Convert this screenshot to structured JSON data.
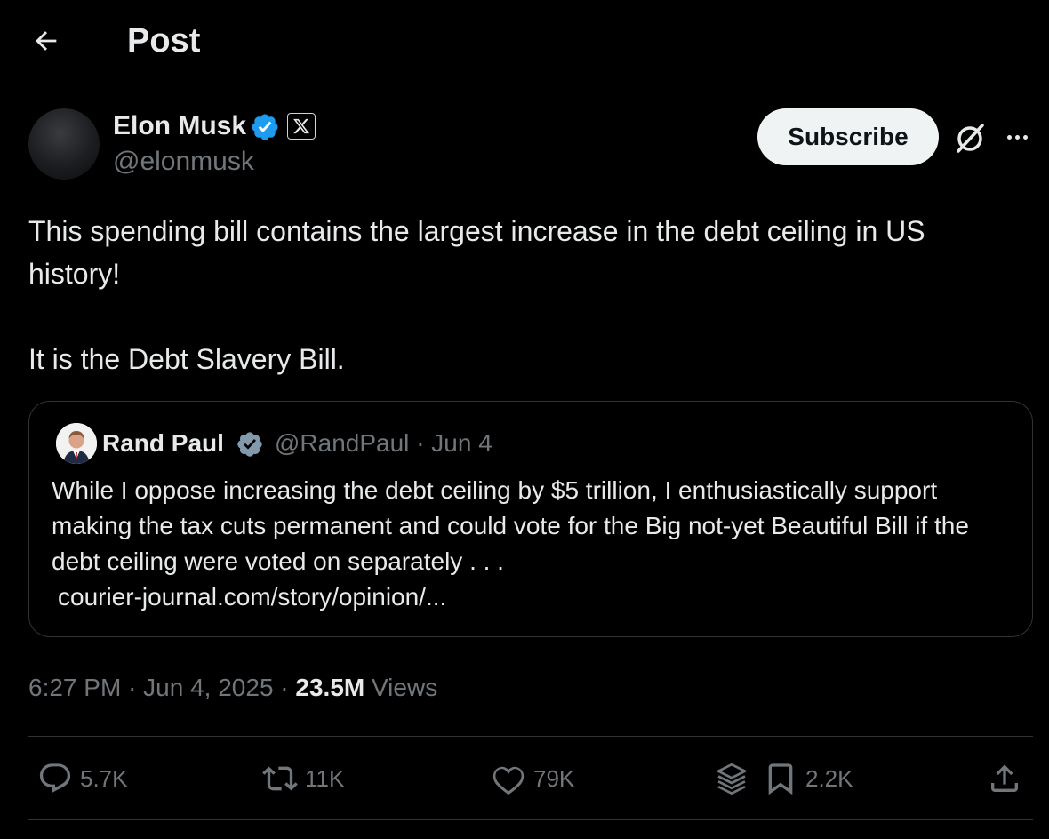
{
  "header": {
    "title": "Post"
  },
  "author": {
    "name": "Elon Musk",
    "handle": "@elonmusk"
  },
  "buttons": {
    "subscribe_label": "Subscribe"
  },
  "post": {
    "paragraphs": [
      "This spending bill contains the largest increase in the debt ceiling in US history!",
      "It is the Debt Slavery Bill."
    ]
  },
  "quote": {
    "name": "Rand Paul",
    "handle": "@RandPaul",
    "date": "Jun 4",
    "text": "While I oppose increasing the debt ceiling by $5 trillion, I enthusiastically support making the tax cuts permanent and could vote for the Big not-yet Beautiful Bill if the debt ceiling were voted on separately . . .",
    "link": "courier-journal.com/story/opinion/..."
  },
  "meta": {
    "time": "6:27 PM",
    "date": "Jun 4, 2025",
    "views_count": "23.5M",
    "views_label": "Views"
  },
  "actions": {
    "replies": "5.7K",
    "reposts": "11K",
    "likes": "79K",
    "bookmarks": "2.2K"
  },
  "icons": {
    "back": "arrow-left-icon",
    "verified": "verified-badge-icon",
    "affiliate": "x-logo-icon",
    "grok": "grok-icon",
    "more": "more-horizontal-icon",
    "reply": "reply-icon",
    "repost": "repost-icon",
    "like": "heart-icon",
    "layers": "layers-icon",
    "bookmark": "bookmark-icon",
    "share": "share-icon"
  },
  "colors": {
    "background": "#000000",
    "text": "#e7e9ea",
    "muted": "#71767b",
    "verified_blue": "#1d9bf0",
    "verified_gray": "#829aab",
    "border": "#2f3336",
    "button_bg": "#eff3f4"
  }
}
